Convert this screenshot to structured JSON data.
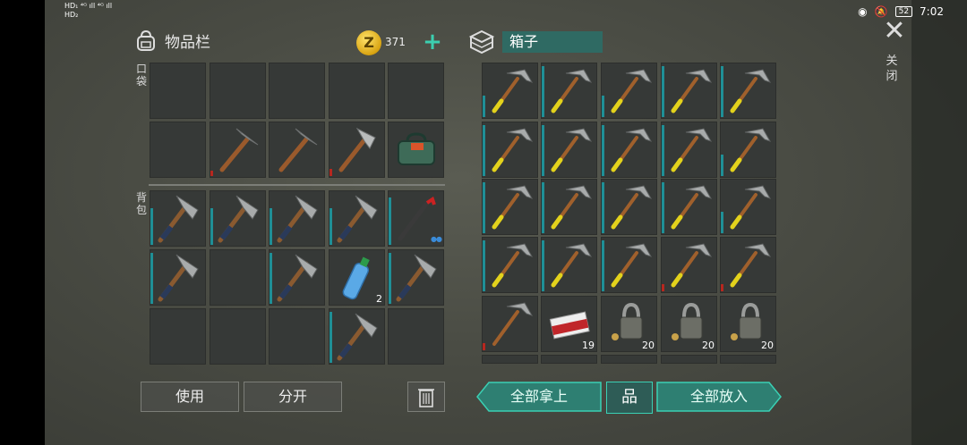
{
  "status_bar": {
    "left_top": "HD₁ ⁴ᴳ ıll ⁴ᴳ ıll",
    "left_bottom": "HD₂",
    "battery": "52",
    "time": "7:02"
  },
  "inventory": {
    "title": "物品栏",
    "coins": "371",
    "pocket_label": "口袋",
    "backpack_label": "背包"
  },
  "box": {
    "title": "箱子"
  },
  "close": {
    "label": "关闭"
  },
  "buttons": {
    "use": "使用",
    "split": "分开",
    "take_all": "全部拿上",
    "sort": "品",
    "put_all": "全部放入"
  },
  "counts": {
    "water_bottle": "2",
    "cigarettes": "19",
    "lock_1": "20",
    "lock_2": "20",
    "lock_3": "20"
  },
  "colors": {
    "accent_teal": "#3ad0b4",
    "quality_bar": "#1f8f96",
    "damaged": "#b7271f",
    "coin": "#d9a412"
  }
}
